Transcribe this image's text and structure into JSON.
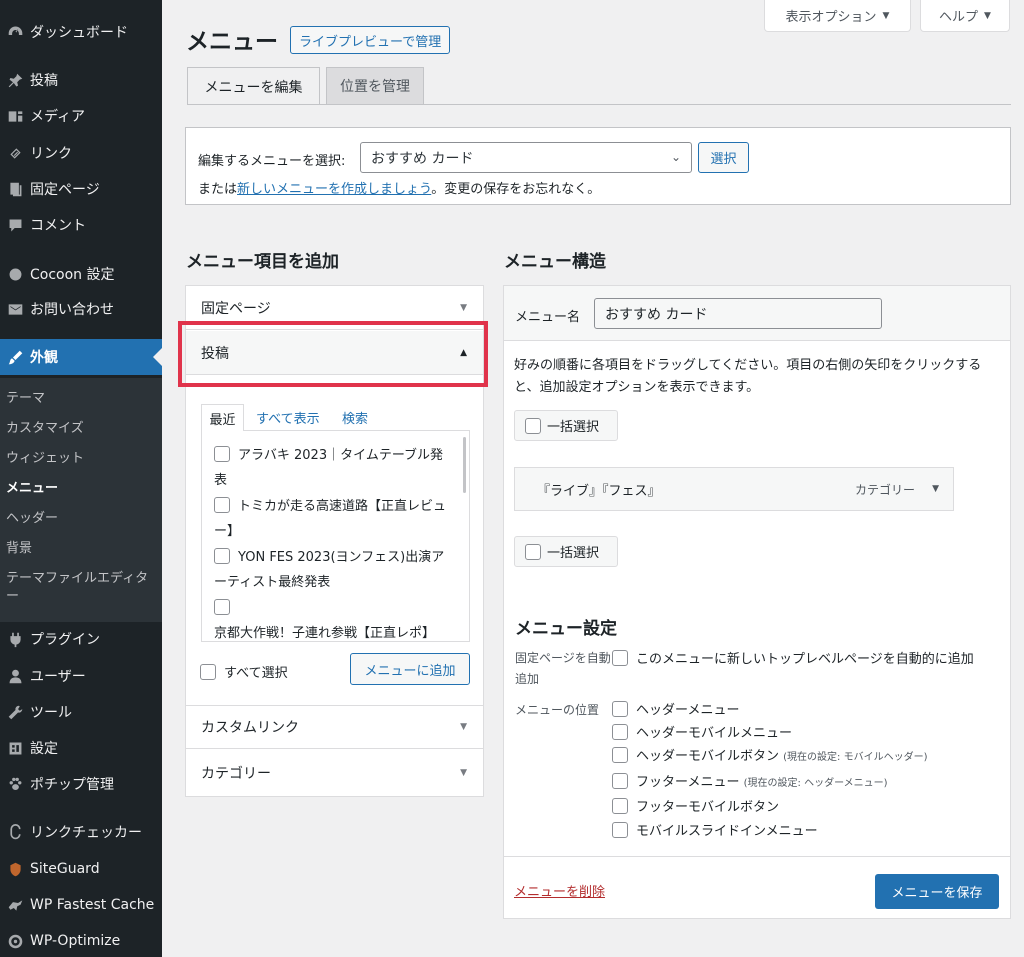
{
  "sidebar": {
    "items": [
      {
        "label": "ダッシュボード",
        "icon": "dashboard-icon"
      },
      {
        "label": "投稿",
        "icon": "pin-icon"
      },
      {
        "label": "メディア",
        "icon": "media-icon"
      },
      {
        "label": "リンク",
        "icon": "link-icon"
      },
      {
        "label": "固定ページ",
        "icon": "page-icon"
      },
      {
        "label": "コメント",
        "icon": "comment-icon"
      },
      {
        "label": "Cocoon 設定",
        "icon": "circle-icon"
      },
      {
        "label": "お問い合わせ",
        "icon": "mail-icon"
      },
      {
        "label": "外観",
        "icon": "brush-icon"
      },
      {
        "label": "プラグイン",
        "icon": "plugin-icon"
      },
      {
        "label": "ユーザー",
        "icon": "user-icon"
      },
      {
        "label": "ツール",
        "icon": "wrench-icon"
      },
      {
        "label": "設定",
        "icon": "settings-icon"
      },
      {
        "label": "ポチップ管理",
        "icon": "paw-icon"
      },
      {
        "label": "リンクチェッカー",
        "icon": "link-checker-icon"
      },
      {
        "label": "SiteGuard",
        "icon": "shield-icon"
      },
      {
        "label": "WP Fastest Cache",
        "icon": "cheetah-icon"
      },
      {
        "label": "WP-Optimize",
        "icon": "optimize-icon"
      }
    ],
    "submenu": [
      "テーマ",
      "カスタマイズ",
      "ウィジェット",
      "メニュー",
      "ヘッダー",
      "背景",
      "テーマファイルエディター"
    ]
  },
  "screen_options": "表示オプション",
  "help": "ヘルプ",
  "title": "メニュー",
  "live_preview": "ライブプレビューで管理",
  "tabs": {
    "edit": "メニューを編集",
    "locations": "位置を管理"
  },
  "select_menu": {
    "label": "編集するメニューを選択:",
    "value": "おすすめ カード",
    "button": "選択",
    "note_prefix": "または",
    "note_link": "新しいメニューを作成しましょう",
    "note_suffix": "。変更の保存をお忘れなく。"
  },
  "add_items": {
    "heading": "メニュー項目を追加",
    "fixed_pages": "固定ページ",
    "posts": "投稿",
    "post_tabs": {
      "recent": "最近",
      "all": "すべて表示",
      "search": "検索"
    },
    "post_list": [
      "アラバキ 2023｜タイムテーブル発表",
      "トミカが走る高速道路【正直レビュー】",
      "YON FES 2023(ヨンフェス)出演アーティスト最終発表",
      "京都大作戦！子連れ参戦【正直レポ】"
    ],
    "select_all": "すべて選択",
    "add_button": "メニューに追加",
    "custom_links": "カスタムリンク",
    "categories": "カテゴリー"
  },
  "structure": {
    "heading": "メニュー構造",
    "name_label": "メニュー名",
    "name_value": "おすすめ カード",
    "instructions": "好みの順番に各項目をドラッグしてください。項目の右側の矢印をクリックすると、追加設定オプションを表示できます。",
    "bulk_select": "一括選択",
    "items": [
      {
        "title": "『ライブ』『フェス』",
        "type": "カテゴリー"
      }
    ]
  },
  "settings": {
    "heading": "メニュー設定",
    "auto_add_label": "固定ページを自動追加",
    "auto_add_option": "このメニューに新しいトップレベルページを自動的に追加",
    "location_label": "メニューの位置",
    "locations": [
      {
        "name": "ヘッダーメニュー",
        "note": ""
      },
      {
        "name": "ヘッダーモバイルメニュー",
        "note": ""
      },
      {
        "name": "ヘッダーモバイルボタン",
        "note": "(現在の設定: モバイルヘッダー)"
      },
      {
        "name": "フッターメニュー",
        "note": "(現在の設定: ヘッダーメニュー)"
      },
      {
        "name": "フッターモバイルボタン",
        "note": ""
      },
      {
        "name": "モバイルスライドインメニュー",
        "note": ""
      }
    ]
  },
  "delete_menu": "メニューを削除",
  "save_menu": "メニューを保存",
  "colors": {
    "sidebar_bg": "#1d2327",
    "accent": "#2271b1",
    "highlight": "#e0334b",
    "delete": "#b32d2e"
  }
}
